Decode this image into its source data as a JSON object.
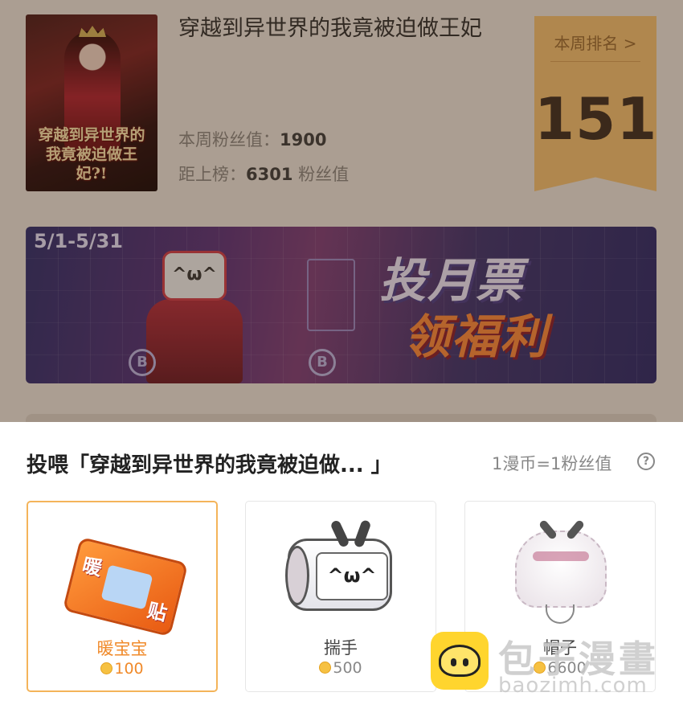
{
  "comic": {
    "title": "穿越到异世界的我竟被迫做王妃",
    "cover_text": "穿越到异世界的我竟被迫做王妃?!",
    "weekly_fans_label": "本周粉丝值：",
    "weekly_fans_value": "1900",
    "to_rank_label": "距上榜：",
    "to_rank_value": "6301",
    "to_rank_unit": "粉丝值"
  },
  "rank": {
    "label": "本周排名 >",
    "value": "151"
  },
  "banner": {
    "date": "5/1-5/31",
    "line1": "投月票",
    "line2": "领福利",
    "logo_char": "B"
  },
  "sheet": {
    "title": "投喂「穿越到异世界的我竟被迫做... 」",
    "rate": "1漫币=1粉丝值",
    "help_icon": "?"
  },
  "gifts": [
    {
      "name": "暖宝宝",
      "price": "100",
      "selected": true,
      "icon": "hand-warmer-icon"
    },
    {
      "name": "揣手",
      "price": "500",
      "selected": false,
      "icon": "muff-icon"
    },
    {
      "name": "帽子",
      "price": "6600",
      "selected": false,
      "icon": "hat-icon"
    }
  ],
  "hand_warmer_text": {
    "char1": "暖",
    "char2": "贴"
  },
  "watermark": {
    "title": "包子漫畫",
    "url": "baozimh.com"
  },
  "colors": {
    "accent": "#f08a2a",
    "rank_badge": "#f7c272",
    "selected_border": "#f4b45a"
  }
}
